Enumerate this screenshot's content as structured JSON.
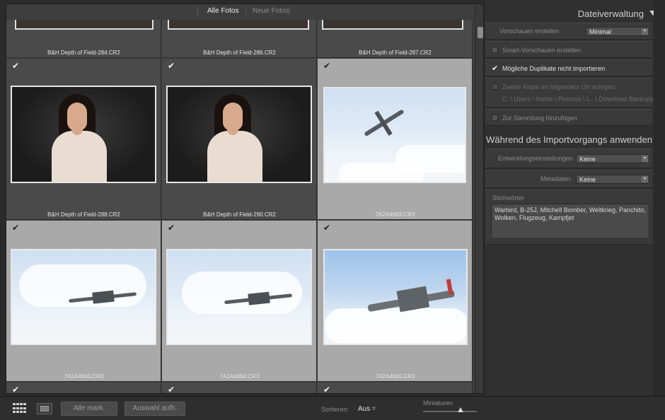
{
  "grid": {
    "tabs": {
      "all": "Alle Fotos",
      "new": "Neue Fotos"
    },
    "top_row_names": [
      "B&H Depth of Field-284.CR2",
      "B&H Depth of Field-286.CR2",
      "B&H Depth of Field-287.CR2"
    ],
    "row1": [
      {
        "name": "B&H Depth of Field-288.CR2",
        "check": "✔"
      },
      {
        "name": "B&H Depth of Field-290.CR2",
        "check": "✔"
      },
      {
        "name": "7A2A4663.CR3",
        "check": "✔"
      }
    ],
    "row2": [
      {
        "name": "7A2A4663.CR3",
        "check": "✔"
      },
      {
        "name": "7A2A4664.CR3",
        "check": "✔"
      },
      {
        "name": "7A2A4665.CR3",
        "check": "✔"
      }
    ],
    "row3_checks": [
      "✔",
      "✔",
      "✔"
    ]
  },
  "toolbar": {
    "select_all": "Alle mark.",
    "deselect": "Auswahl aufh.",
    "sort_label": "Sortieren:",
    "sort_value": "Aus",
    "sort_arrows": "≑",
    "thumbnails_label": "Miniaturen",
    "thumbnail_size": 0.7
  },
  "panel": {
    "file_handling": {
      "title": "Dateiverwaltung",
      "previews_label": "Vorschauen erstellen",
      "previews_value": "Minimal",
      "smart_previews": "Smart-Vorschauen erstellen",
      "no_duplicates": "Mögliche Duplikate nicht importieren",
      "second_copy": "Zweite Kopie an folgendem Ort anlegen:",
      "second_copy_path": "C: \\ Users \\ Isolde \\ Pictures \\ L...\\ Download Backups",
      "add_collection": "Zur Sammlung hinzufügen"
    },
    "apply": {
      "title": "Während des Importvorgangs anwenden",
      "develop_label": "Entwicklungseinstellungen",
      "develop_value": "Keine",
      "metadata_label": "Metadaten",
      "metadata_value": "Keine",
      "keywords_label": "Stichwörter",
      "keywords": "Warbird, B-25J, Mitchell Bomber, Weltkrieg, Panchito, Wolken, Flugzeug, Kampfjet"
    }
  }
}
